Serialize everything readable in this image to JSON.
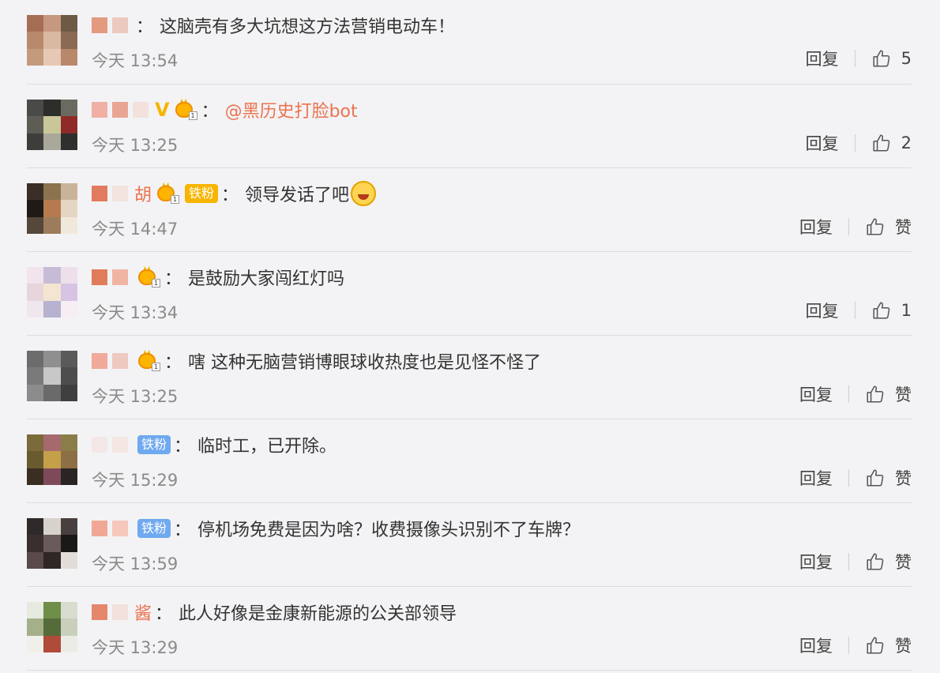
{
  "comments": [
    {
      "avatar_colors": [
        "#a66d55",
        "#c79880",
        "#6e5a44",
        "#b88a6c",
        "#d9b9a0",
        "#8a6a52",
        "#c49a7c",
        "#e6c9b4",
        "#b9886a"
      ],
      "name_blocks": [
        {
          "color": "#e49a7e"
        },
        {
          "color": "#e07c5b",
          "light": true
        }
      ],
      "name_text": "",
      "badge": null,
      "mention": "",
      "text": "这脑壳有多大坑想这方法营销电动车！",
      "emoji": false,
      "time": "今天 13:54",
      "reply": "回复",
      "likes": "5"
    },
    {
      "avatar_colors": [
        "#4a4a48",
        "#2d2d2c",
        "#6b6a60",
        "#5d5c55",
        "#c9c79a",
        "#8e2b28",
        "#3d3d3b",
        "#a9a89a",
        "#2f2f2e"
      ],
      "name_blocks": [
        {
          "color": "#f1b0a4"
        },
        {
          "color": "#e9a594"
        },
        {
          "color": "#f0c0b2",
          "light": true
        }
      ],
      "name_text": "",
      "v_mark": "V",
      "badge": "crown",
      "mention": "@黑历史打脸bot",
      "text": "",
      "emoji": false,
      "time": "今天 13:25",
      "reply": "回复",
      "likes": "2"
    },
    {
      "avatar_colors": [
        "#3a2f27",
        "#8b7350",
        "#c9b499",
        "#1f1a16",
        "#b67a4f",
        "#e4d6c2",
        "#55473a",
        "#9c7c5d",
        "#f1e8dc"
      ],
      "name_blocks": [
        {
          "color": "#e27b5e"
        },
        {
          "color": "#f2c6b8",
          "light": true
        }
      ],
      "name_text": "胡",
      "badge": "crown",
      "tiefen": "铁粉",
      "tiefen_style": "gold",
      "mention": "",
      "text": "领导发话了吧",
      "emoji": true,
      "time": "今天 14:47",
      "reply": "回复",
      "likes": "赞"
    },
    {
      "avatar_colors": [
        "#f2e4ec",
        "#c7bcd8",
        "#ede0ea",
        "#e6d6dc",
        "#f3e5d0",
        "#d7c3e3",
        "#f0e6ee",
        "#b7b2d0",
        "#f6eef4"
      ],
      "name_blocks": [
        {
          "color": "#e07c5b"
        },
        {
          "color": "#f1b4a2"
        }
      ],
      "name_text": "",
      "badge": "crown",
      "mention": "",
      "text": "是鼓励大家闯红灯吗",
      "emoji": false,
      "time": "今天 13:34",
      "reply": "回复",
      "likes": "1"
    },
    {
      "avatar_colors": [
        "#6c6c6c",
        "#8f8f8f",
        "#5a5a5a",
        "#7a7a7a",
        "#c8c8c8",
        "#4d4d4d",
        "#8c8c8c",
        "#6a6a6a",
        "#3f3f3f"
      ],
      "name_blocks": [
        {
          "color": "#f1a99a"
        },
        {
          "color": "#e27b5e",
          "light": true
        }
      ],
      "name_text": "",
      "badge": "crown",
      "mention": "",
      "text": "嗐 这种无脑营销博眼球收热度也是见怪不怪了",
      "emoji": false,
      "time": "今天 13:25",
      "reply": "回复",
      "likes": "赞"
    },
    {
      "avatar_colors": [
        "#7b6a3a",
        "#a66a6e",
        "#8a7d4a",
        "#6a5a30",
        "#c4a04a",
        "#8c6f44",
        "#3a2e22",
        "#7e4a5a",
        "#2a2424"
      ],
      "name_blocks": [
        {
          "color": "#f6d5cc",
          "light": true
        },
        {
          "color": "#f5cfc3",
          "light": true
        }
      ],
      "name_text": "",
      "badge": null,
      "tiefen": "铁粉",
      "tiefen_style": "blue",
      "mention": "",
      "text": "临时工，已开除。",
      "emoji": false,
      "time": "今天 15:29",
      "reply": "回复",
      "likes": "赞"
    },
    {
      "avatar_colors": [
        "#2e2a2a",
        "#d8d2cc",
        "#4a3f3f",
        "#3a2f2f",
        "#6a5a5a",
        "#1c1818",
        "#5a4a4a",
        "#2f2626",
        "#e2ddd8"
      ],
      "name_blocks": [
        {
          "color": "#f0a796"
        },
        {
          "color": "#f6c7bb"
        }
      ],
      "name_text": "",
      "badge": null,
      "tiefen": "铁粉",
      "tiefen_style": "blue",
      "mention": "",
      "text": "停机场免费是因为啥？收费摄像头识别不了车牌？",
      "emoji": false,
      "time": "今天 13:59",
      "reply": "回复",
      "likes": "赞"
    },
    {
      "avatar_colors": [
        "#e6eadf",
        "#6f8e4a",
        "#d9ddd0",
        "#a4b08a",
        "#556b3a",
        "#c8d0bc",
        "#f0f0ea",
        "#b04a3a",
        "#ecece6"
      ],
      "name_blocks": [
        {
          "color": "#e4876b"
        },
        {
          "color": "#f3c0b2",
          "light": true
        }
      ],
      "name_text": "酱",
      "badge": null,
      "mention": "",
      "text": "此人好像是金康新能源的公关部领导",
      "emoji": false,
      "time": "今天 13:29",
      "reply": "回复",
      "likes": "赞"
    }
  ]
}
